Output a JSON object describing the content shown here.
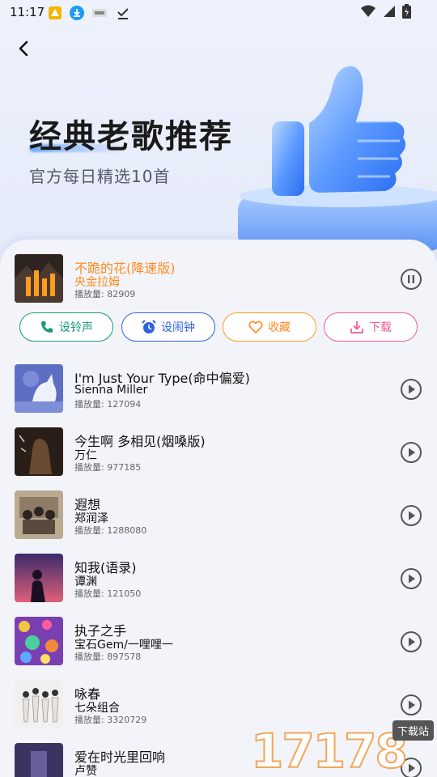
{
  "status_bar": {
    "time": "11:17"
  },
  "header": {
    "title": "经典老歌推荐",
    "subtitle": "官方每日精选10首"
  },
  "now_playing": {
    "title": "不跪的花(降速版)",
    "artist": "央金拉姆",
    "plays": "播放量: 82909"
  },
  "actions": {
    "ringtone": "设铃声",
    "alarm": "设闹钟",
    "favorite": "收藏",
    "download": "下载"
  },
  "songs": [
    {
      "title": "I'm Just Your Type(命中偏爱)",
      "artist": "Sienna Miller",
      "plays": "播放量: 127094"
    },
    {
      "title": "今生啊 多相见(烟嗓版)",
      "artist": "万仁",
      "plays": "播放量: 977185"
    },
    {
      "title": "遐想",
      "artist": "郑润泽",
      "plays": "播放量: 1288080"
    },
    {
      "title": "知我(语录)",
      "artist": "谭渊",
      "plays": "播放量: 121050"
    },
    {
      "title": "执子之手",
      "artist": "宝石Gem/一哩哩一",
      "plays": "播放量: 897578"
    },
    {
      "title": "咏春",
      "artist": "七朵组合",
      "plays": "播放量: 3320729"
    },
    {
      "title": "爱在时光里回响",
      "artist": "卢赞",
      "plays": ""
    }
  ],
  "watermark": {
    "digits": "17178",
    "badge": "下载站"
  },
  "colors": {
    "accent_orange": "#ff8a1f",
    "ringtone": "#1a9a7a",
    "alarm": "#2f62e6",
    "favorite": "#ff9a1f",
    "download": "#ee5a9a"
  }
}
